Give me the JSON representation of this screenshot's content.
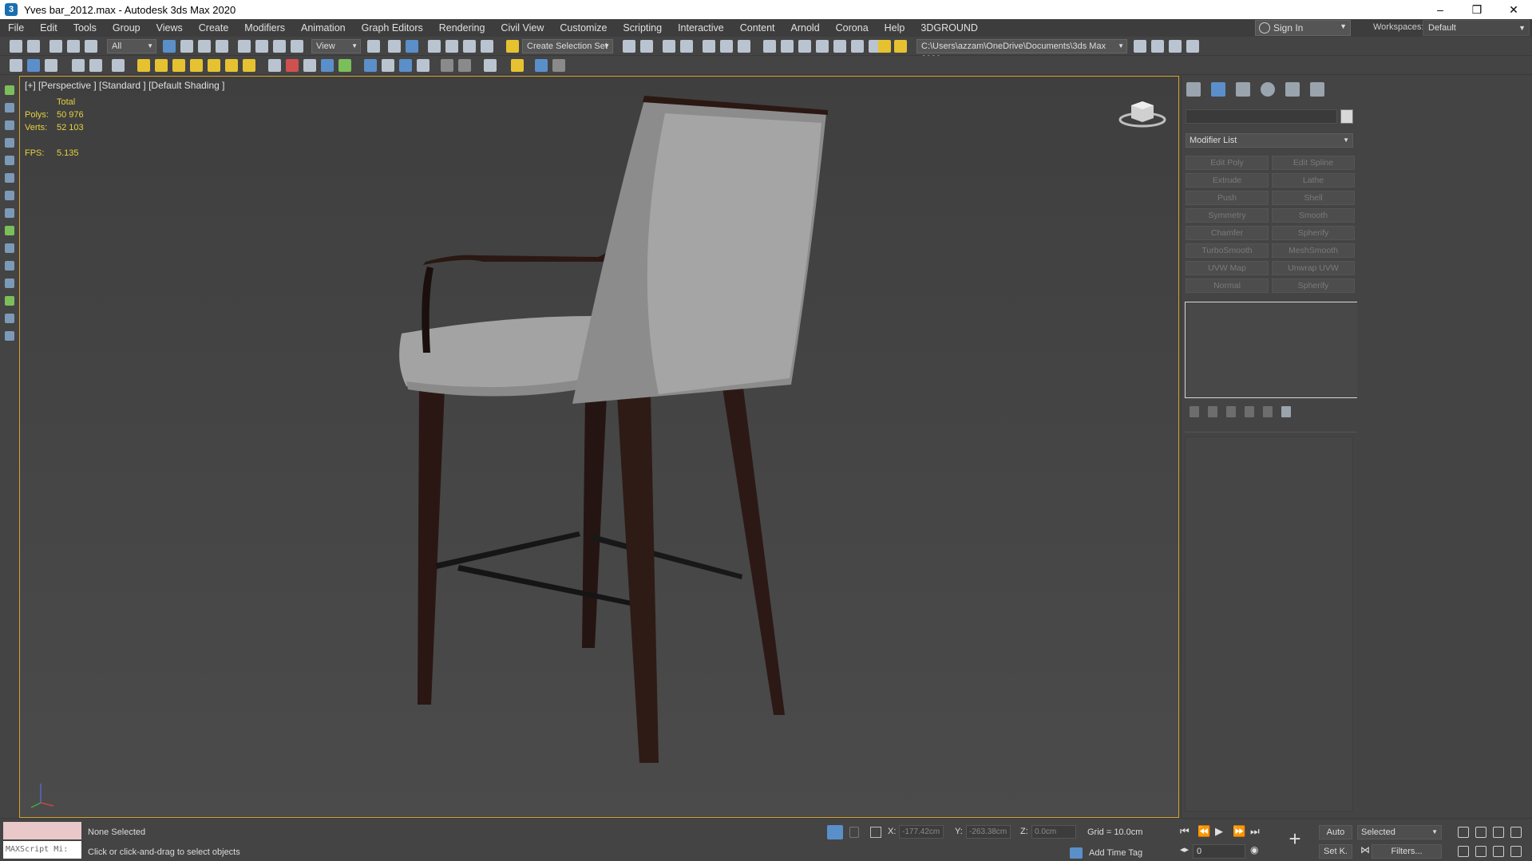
{
  "window": {
    "title": "Yves bar_2012.max - Autodesk 3ds Max 2020",
    "app_icon": "3",
    "controls": [
      "minimize-icon",
      "restore-icon",
      "close-icon"
    ],
    "minimize": "–",
    "restore": "❒",
    "close": "✕"
  },
  "menubar": {
    "items": [
      "File",
      "Edit",
      "Tools",
      "Group",
      "Views",
      "Create",
      "Modifiers",
      "Animation",
      "Graph Editors",
      "Rendering",
      "Civil View",
      "Customize",
      "Scripting",
      "Interactive",
      "Content",
      "Arnold",
      "Corona",
      "Help",
      "3DGROUND"
    ],
    "sign_in": "Sign In",
    "workspaces_label": "Workspaces:",
    "workspace_value": "Default"
  },
  "toolbar1": {
    "filter_value": "All",
    "ref_coord_value": "View",
    "selection_set_value": "Create Selection Set",
    "project_path": "C:\\Users\\azzam\\OneDrive\\Documents\\3ds Max 2020"
  },
  "viewport": {
    "label": "[+] [Perspective ] [Standard ] [Default Shading ]",
    "stats_header": "Total",
    "polys_label": "Polys:",
    "polys_value": "50 976",
    "verts_label": "Verts:",
    "verts_value": "52 103",
    "fps_label": "FPS:",
    "fps_value": "5.135"
  },
  "command_panel": {
    "modifier_list_label": "Modifier List",
    "modifier_buttons": [
      "Edit Poly",
      "Edit Spline",
      "Extrude",
      "Lathe",
      "Push",
      "Shell",
      "Symmetry",
      "Smooth",
      "Chamfer",
      "Spherify",
      "TurboSmooth",
      "MeshSmooth",
      "UVW Map",
      "Unwrap UVW",
      "Normal",
      "Spherify"
    ]
  },
  "status": {
    "maxscript_label": "MAXScript Mi:",
    "selection": "None Selected",
    "prompt": "Click or click-and-drag to select objects",
    "x_label": "X:",
    "x_value": "-177.42cm",
    "y_label": "Y:",
    "y_value": "-263.38cm",
    "z_label": "Z:",
    "z_value": "0.0cm",
    "grid": "Grid = 10.0cm",
    "add_time_tag": "Add Time Tag",
    "frame_value": "0",
    "auto_key": "Auto",
    "set_key": "Set K.",
    "selected": "Selected",
    "filters": "Filters..."
  },
  "colors": {
    "viewport_border": "#d4a22c",
    "stats_text": "#e6d23e",
    "accent_blue": "#5b8fc9",
    "chair_upholstery": "#9a9a9a",
    "chair_wood": "#2e1b16"
  }
}
